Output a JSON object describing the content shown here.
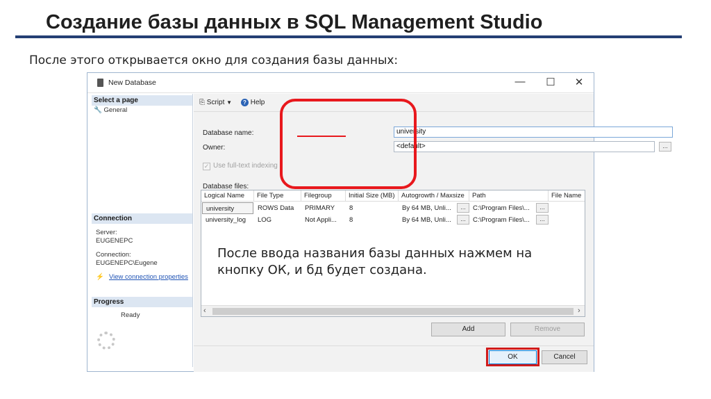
{
  "slide": {
    "title": "Создание базы данных в SQL Management Studio",
    "subtitle": "После этого открывается окно для создания базы данных:",
    "annotation": "После ввода названия базы данных нажмем на кнопку ОК, и бд будет создана."
  },
  "window": {
    "title": "New Database",
    "controls": {
      "minimize": "—",
      "maximize": "☐",
      "close": "✕"
    }
  },
  "left_pane": {
    "select_page_header": "Select a page",
    "pages": [
      "General"
    ],
    "connection_header": "Connection",
    "server_label": "Server:",
    "server_value": "EUGENEPC",
    "connection_label": "Connection:",
    "connection_value": "EUGENEPC\\Eugene",
    "view_props_link": "View connection properties",
    "progress_header": "Progress",
    "progress_status": "Ready"
  },
  "toolbar": {
    "script_label": "Script",
    "help_label": "Help"
  },
  "form": {
    "db_name_label": "Database name:",
    "db_name_value": "university",
    "owner_label": "Owner:",
    "owner_value": "<default>",
    "fulltext_label": "Use full-text indexing",
    "files_label": "Database files:"
  },
  "files_table": {
    "columns": [
      "Logical Name",
      "File Type",
      "Filegroup",
      "Initial Size (MB)",
      "Autogrowth / Maxsize",
      "Path",
      "File Name"
    ],
    "rows": [
      [
        "university",
        "ROWS Data",
        "PRIMARY",
        "8",
        "By 64 MB, Unli...",
        "C:\\Program Files\\...",
        ""
      ],
      [
        "university_log",
        "LOG",
        "Not Appli...",
        "8",
        "By 64 MB, Unli...",
        "C:\\Program Files\\...",
        ""
      ]
    ]
  },
  "buttons": {
    "add": "Add",
    "remove": "Remove",
    "ok": "OK",
    "cancel": "Cancel",
    "ellipsis": "..."
  },
  "colors": {
    "accent_red": "#e8181d",
    "title_rule": "#243f74",
    "section_header": "#dce6f2"
  }
}
